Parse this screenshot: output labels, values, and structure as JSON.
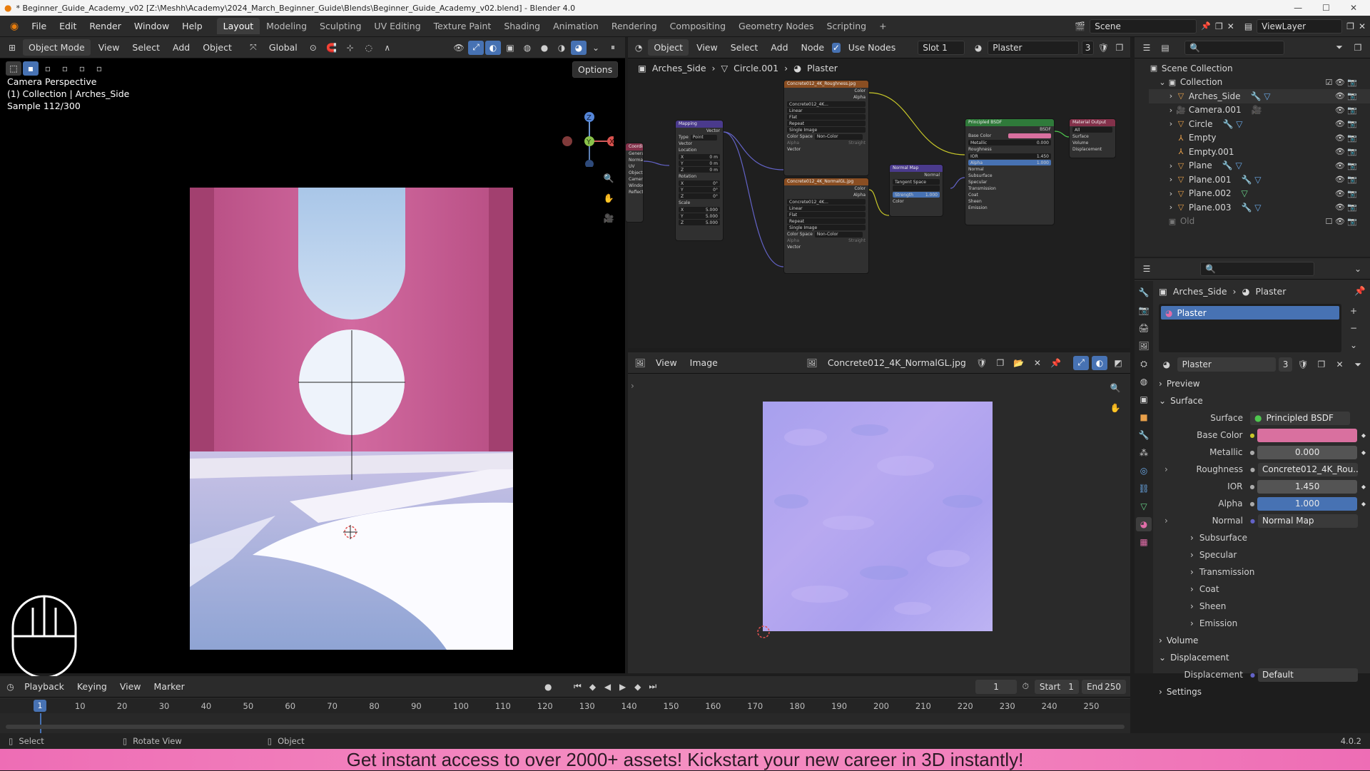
{
  "window": {
    "title": "* Beginner_Guide_Academy_v02 [Z:\\Meshh\\Academy\\2024_March_Beginner_Guide\\Blends\\Beginner_Guide_Academy_v02.blend] - Blender 4.0"
  },
  "menus": [
    "File",
    "Edit",
    "Render",
    "Window",
    "Help"
  ],
  "workspaces": [
    "Layout",
    "Modeling",
    "Sculpting",
    "UV Editing",
    "Texture Paint",
    "Shading",
    "Animation",
    "Rendering",
    "Compositing",
    "Geometry Nodes",
    "Scripting"
  ],
  "active_workspace": "Layout",
  "scene": {
    "label": "Scene",
    "view_layer": "ViewLayer"
  },
  "viewport": {
    "mode": "Object Mode",
    "menus": [
      "View",
      "Select",
      "Add",
      "Object"
    ],
    "orientation": "Global",
    "options": "Options",
    "info_line1": "Camera Perspective",
    "info_line2": "(1) Collection | Arches_Side",
    "info_line3": "Sample 112/300"
  },
  "node_editor": {
    "object_type": "Object",
    "menus": [
      "View",
      "Select",
      "Add",
      "Node"
    ],
    "use_nodes": "Use Nodes",
    "slot": "Slot 1",
    "material": "Plaster",
    "users": "3",
    "breadcrumb": [
      "Arches_Side",
      "Circle.001",
      "Plaster"
    ],
    "nodes": {
      "mapping": {
        "title": "Mapping",
        "type_label": "Type",
        "type_value": "Point",
        "vector": "Vector",
        "location": "Location",
        "rotation": "Rotation",
        "scale": "Scale",
        "loc": [
          "0 m",
          "0 m",
          "0 m"
        ],
        "rot": [
          "0°",
          "0°",
          "0°"
        ],
        "scl": [
          "5.000",
          "5.000",
          "5.000"
        ]
      },
      "texcoord": {
        "title": "Coordinate",
        "outputs": [
          "Generated",
          "Normal",
          "UV",
          "Object",
          "Camera",
          "Window",
          "Reflection"
        ]
      },
      "rough_img": {
        "title": "Concrete012_4K_Roughness.jpg",
        "file": "Concrete012_4K...",
        "outputs": [
          "Color",
          "Alpha"
        ],
        "opts": [
          "Linear",
          "Flat",
          "Repeat",
          "Single Image"
        ],
        "cs_label": "Color Space",
        "cs_value": "Non-Color",
        "alpha_label": "Alpha",
        "alpha_value": "Straight",
        "vector": "Vector"
      },
      "normal_img": {
        "title": "Concrete012_4K_NormalGL.jpg",
        "file": "Concrete012_4K...",
        "outputs": [
          "Color",
          "Alpha"
        ],
        "opts": [
          "Linear",
          "Flat",
          "Repeat",
          "Single Image"
        ],
        "cs_label": "Color Space",
        "cs_value": "Non-Color",
        "alpha_label": "Alpha",
        "alpha_value": "Straight",
        "vector": "Vector"
      },
      "normal_map": {
        "title": "Normal Map",
        "output": "Normal",
        "space": "Tangent Space",
        "strength_label": "Strength",
        "strength": "1.000",
        "color": "Color"
      },
      "bsdf": {
        "title": "Principled BSDF",
        "output": "BSDF",
        "rows": [
          "Base Color",
          "Metallic",
          "Roughness",
          "IOR",
          "Alpha",
          "Normal"
        ],
        "metallic": "0.000",
        "ior": "1.450",
        "alpha": "1.000",
        "subs": [
          "Subsurface",
          "Specular",
          "Transmission",
          "Coat",
          "Sheen",
          "Emission"
        ]
      },
      "output": {
        "title": "Material Output",
        "target": "All",
        "inputs": [
          "Surface",
          "Volume",
          "Displacement"
        ]
      }
    }
  },
  "image_editor": {
    "menus": [
      "View",
      "Image"
    ],
    "image_name": "Concrete012_4K_NormalGL.jpg"
  },
  "outliner": {
    "root": "Scene Collection",
    "collection": "Collection",
    "items": [
      "Arches_Side",
      "Camera.001",
      "Circle",
      "Empty",
      "Empty.001",
      "Plane",
      "Plane.001",
      "Plane.002",
      "Plane.003"
    ],
    "old": "Old"
  },
  "properties": {
    "breadcrumb": [
      "Arches_Side",
      "Plaster"
    ],
    "slot_material": "Plaster",
    "material_name": "Plaster",
    "users": "3",
    "preview": "Preview",
    "surface_section": "Surface",
    "surface_label": "Surface",
    "surface_value": "Principled BSDF",
    "base_color_label": "Base Color",
    "base_color": "#d9709f",
    "metallic_label": "Metallic",
    "metallic": "0.000",
    "roughness_label": "Roughness",
    "roughness": "Concrete012_4K_Rou...",
    "ior_label": "IOR",
    "ior": "1.450",
    "alpha_label": "Alpha",
    "alpha": "1.000",
    "normal_label": "Normal",
    "normal": "Normal Map",
    "subsections": [
      "Subsurface",
      "Specular",
      "Transmission",
      "Coat",
      "Sheen",
      "Emission"
    ],
    "volume": "Volume",
    "displacement_section": "Displacement",
    "displacement_label": "Displacement",
    "displacement": "Default",
    "settings": "Settings"
  },
  "timeline": {
    "menus": [
      "Playback",
      "Keying",
      "View",
      "Marker"
    ],
    "current_frame": "1",
    "start_label": "Start",
    "start": "1",
    "end_label": "End",
    "end": "250",
    "ticks": [
      "10",
      "20",
      "30",
      "40",
      "50",
      "60",
      "70",
      "80",
      "90",
      "100",
      "110",
      "120",
      "130",
      "140",
      "150",
      "160",
      "170",
      "180",
      "190",
      "200",
      "210",
      "220",
      "230",
      "240",
      "250"
    ],
    "playhead_label": "1"
  },
  "status": {
    "select": "Select",
    "rotate": "Rotate View",
    "object": "Object",
    "version": "4.0.2"
  },
  "banner": "Get instant access to over 2000+ assets! Kickstart your new career in 3D instantly!"
}
